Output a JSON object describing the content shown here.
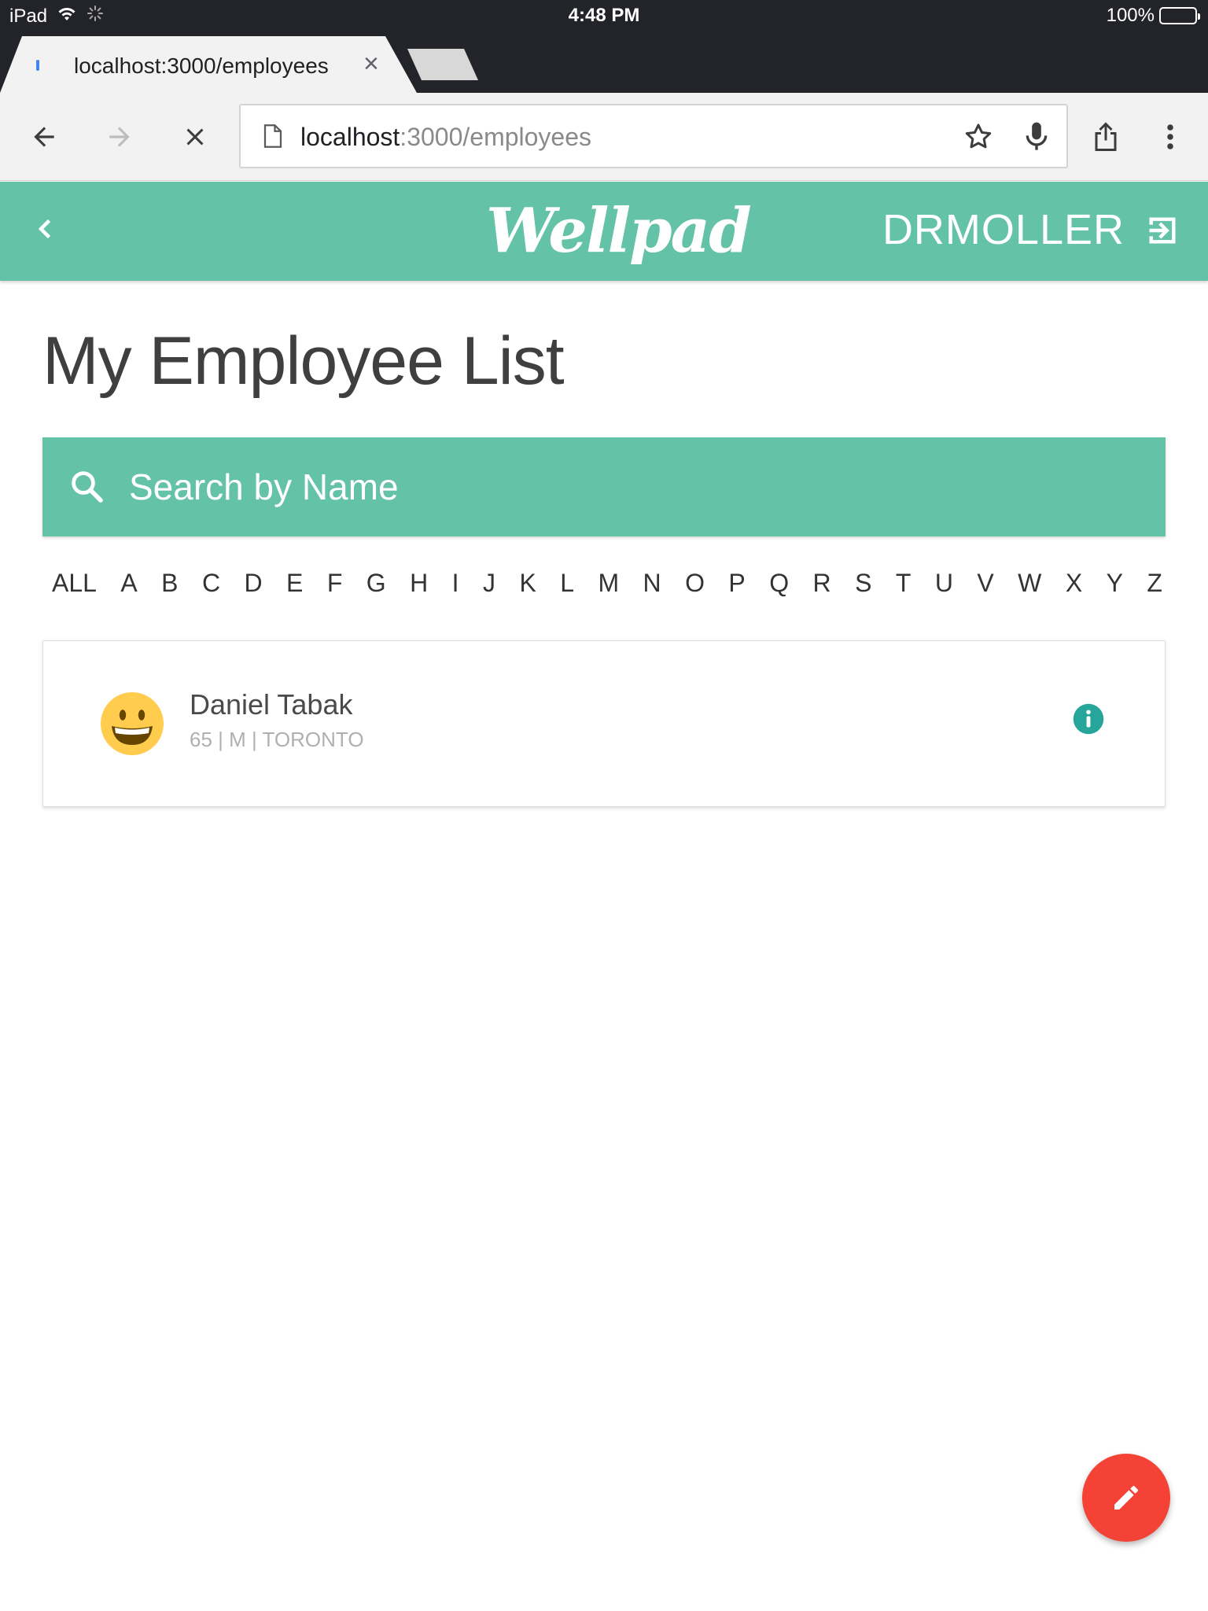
{
  "status_bar": {
    "device": "iPad",
    "time": "4:48 PM",
    "battery": "100%",
    "battery_level": 1.0
  },
  "browser": {
    "tab_title": "localhost:3000/employees",
    "url_host": "localhost",
    "url_path": ":3000/employees"
  },
  "app": {
    "logo": "Wellpad",
    "username": "DRMOLLER",
    "brand_color": "#64c2a6"
  },
  "page": {
    "title": "My Employee List"
  },
  "search": {
    "placeholder": "Search by Name"
  },
  "alphabet": [
    "ALL",
    "A",
    "B",
    "C",
    "D",
    "E",
    "F",
    "G",
    "H",
    "I",
    "J",
    "K",
    "L",
    "M",
    "N",
    "O",
    "P",
    "Q",
    "R",
    "S",
    "T",
    "U",
    "V",
    "W",
    "X",
    "Y",
    "Z"
  ],
  "employees": [
    {
      "name": "Daniel Tabak",
      "meta": "65 | M | TORONTO",
      "avatar": "grinning-face-emoji"
    }
  ],
  "fab": {
    "icon": "pencil-icon",
    "color": "#f44336"
  }
}
